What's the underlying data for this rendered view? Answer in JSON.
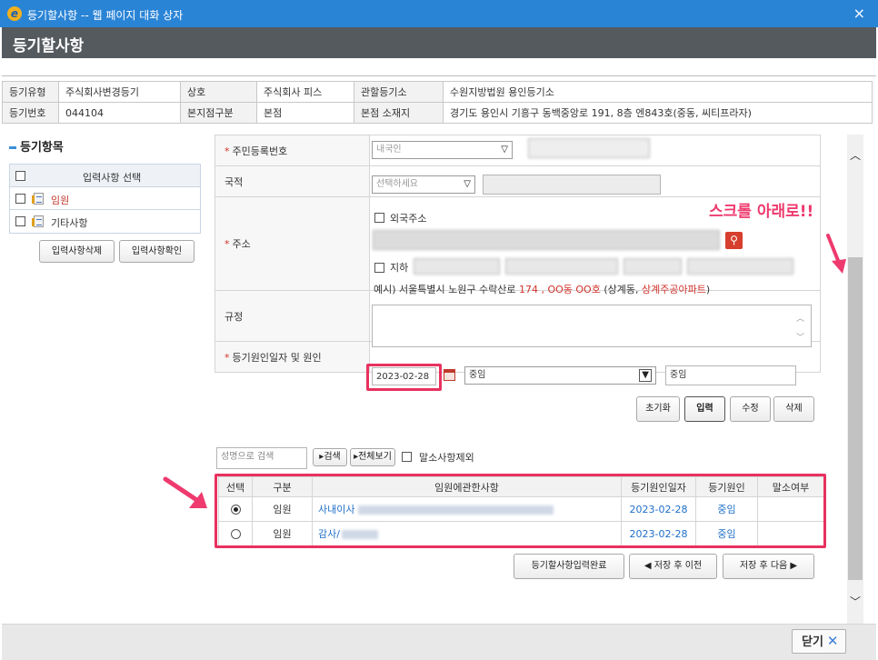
{
  "window": {
    "title": "등기할사항 -- 웹 페이지 대화 상자",
    "close_glyph": "×"
  },
  "page_title": "등기할사항",
  "info": {
    "row1": [
      {
        "label": "등기유형",
        "value": "주식회사변경등기"
      },
      {
        "label": "상호",
        "value": "주식회사 피스"
      },
      {
        "label": "관할등기소",
        "value": "수원지방법원 용인등기소"
      }
    ],
    "row2": [
      {
        "label": "등기번호",
        "value": "044104"
      },
      {
        "label": "본지점구분",
        "value": "본점"
      },
      {
        "label": "본점 소재지",
        "value": "경기도 용인시 기흥구 동백중앙로 191, 8층 엔843호(중동, 씨티프라자)"
      }
    ]
  },
  "left_panel": {
    "title": "등기항목",
    "header": "입력사항 선택",
    "items": [
      {
        "label": "임원",
        "highlight": true
      },
      {
        "label": "기타사항",
        "highlight": false
      }
    ],
    "delete_button": "입력사항삭제",
    "confirm_button": "입력사항확인"
  },
  "form": {
    "resident_label": "주민등록번호",
    "resident_select": "내국인",
    "nationality_label": "국적",
    "nationality_select": "선택하세요",
    "address_label": "주소",
    "foreign_address": "외국주소",
    "basement": "지하",
    "example": {
      "prefix": "예시) 서울특별시 노원구 수락산로",
      "num": "174 , OO동 OO호",
      "mid": "(상계동,",
      "apt": "상계주공아파트",
      "suffix": ")"
    },
    "rule_label": "규정",
    "cause_label": "등기원인일자 및 원인",
    "cause_date": "2023-02-28",
    "cause_select": "중임",
    "cause_text": "중임"
  },
  "actions": {
    "reset": "초기화",
    "input": "입력",
    "edit": "수정",
    "delete": "삭제"
  },
  "search": {
    "placeholder": "성명으로 검색",
    "search_button": "검색",
    "view_all_button": "전체보기",
    "exclude_label": "말소사항제외"
  },
  "table": {
    "headers": [
      "선택",
      "구분",
      "임원에관한사항",
      "등기원인일자",
      "등기원인",
      "말소여부"
    ],
    "rows": [
      {
        "selected": true,
        "type": "임원",
        "detail": "사내이사",
        "date": "2023-02-28",
        "cause": "중임",
        "deleted": ""
      },
      {
        "selected": false,
        "type": "임원",
        "detail": "감사/",
        "date": "2023-02-28",
        "cause": "중임",
        "deleted": ""
      }
    ]
  },
  "bottom_buttons": {
    "complete": "등기할사항입력완료",
    "prev": "저장 후 이전",
    "next": "저장 후 다음"
  },
  "annotation": "스크롤 아래로!!",
  "footer": {
    "close": "닫기"
  },
  "colors": {
    "titlebar": "#2a84d6",
    "header": "#555a5f",
    "highlight": "#e8315f",
    "required": "#d0322b",
    "link_blue": "#1f6fc9"
  }
}
